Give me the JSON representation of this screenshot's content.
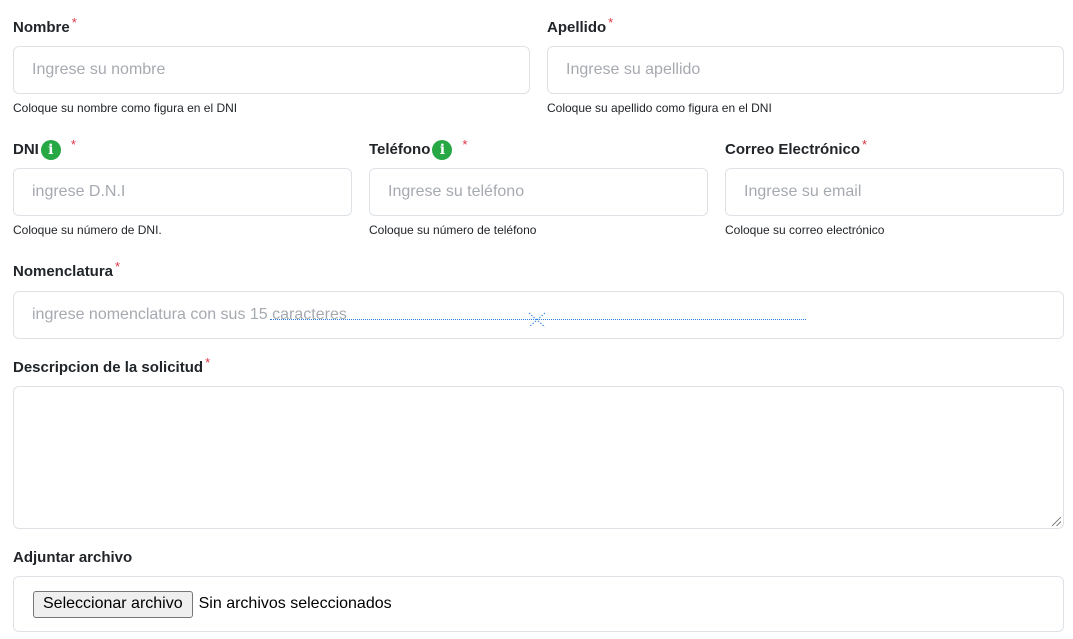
{
  "form": {
    "nombre": {
      "label": "Nombre",
      "required": "*",
      "placeholder": "Ingrese su nombre",
      "help": "Coloque su nombre como figura en el DNI"
    },
    "apellido": {
      "label": "Apellido",
      "required": "*",
      "placeholder": "Ingrese su apellido",
      "help": "Coloque su apellido como figura en el DNI"
    },
    "dni": {
      "label": "DNI",
      "info": "i",
      "required": "*",
      "placeholder": "ingrese D.N.I",
      "help": "Coloque su número de DNI."
    },
    "telefono": {
      "label": "Teléfono",
      "info": "i",
      "required": "*",
      "placeholder": "Ingrese su teléfono",
      "help": "Coloque su número de teléfono"
    },
    "correo": {
      "label": "Correo Electrónico",
      "required": "*",
      "placeholder": "Ingrese su email",
      "help": "Coloque su correo electrónico"
    },
    "nomenclatura": {
      "label": "Nomenclatura",
      "required": "*",
      "placeholder": "ingrese nomenclatura con sus 15 caracteres"
    },
    "descripcion": {
      "label": "Descripcion de la solicitud",
      "required": "*"
    },
    "adjunto": {
      "label": "Adjuntar archivo",
      "button": "Seleccionar archivo",
      "status": "Sin archivos seleccionados"
    }
  },
  "colors": {
    "required": "#dc3545",
    "info_badge": "#28a745",
    "border": "#dee2e6",
    "placeholder": "#a6aab0"
  }
}
